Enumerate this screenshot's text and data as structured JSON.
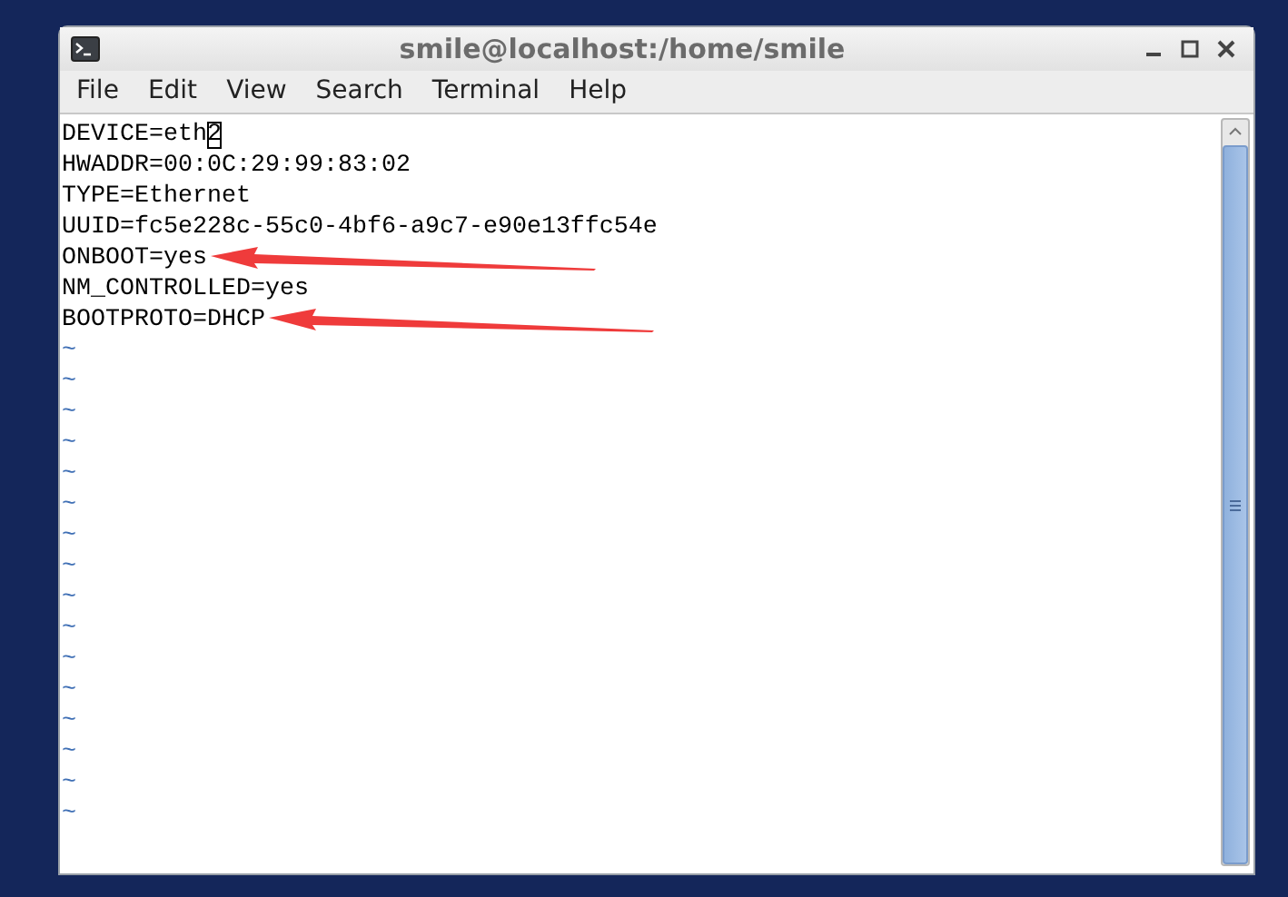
{
  "window": {
    "title": "smile@localhost:/home/smile"
  },
  "menu": [
    "File",
    "Edit",
    "View",
    "Search",
    "Terminal",
    "Help"
  ],
  "lines": [
    {
      "text": "DEVICE=eth2",
      "cursor": true,
      "arrow": false
    },
    {
      "text": "HWADDR=00:0C:29:99:83:02",
      "cursor": false,
      "arrow": false
    },
    {
      "text": "TYPE=Ethernet",
      "cursor": false,
      "arrow": false
    },
    {
      "text": "UUID=fc5e228c-55c0-4bf6-a9c7-e90e13ffc54e",
      "cursor": false,
      "arrow": false
    },
    {
      "text": "ONBOOT=yes",
      "cursor": false,
      "arrow": true
    },
    {
      "text": "NM_CONTROLLED=yes",
      "cursor": false,
      "arrow": false
    },
    {
      "text": "BOOTPROTO=DHCP",
      "cursor": false,
      "arrow": true
    }
  ],
  "empty_lines": [
    "~",
    "~",
    "~",
    "~",
    "~",
    "~",
    "~",
    "~",
    "~",
    "~",
    "~",
    "~",
    "~",
    "~",
    "~",
    "~"
  ]
}
